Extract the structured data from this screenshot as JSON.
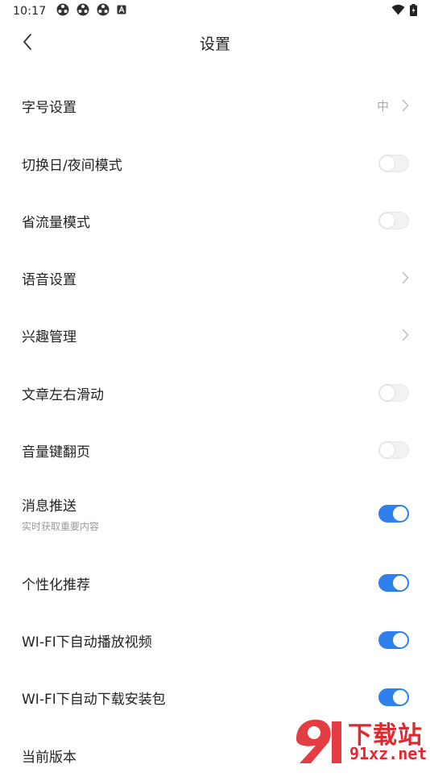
{
  "status_bar": {
    "time": "10:17",
    "notification_icons": [
      "app-icon",
      "app-icon",
      "app-icon",
      "a-icon"
    ],
    "right_icons": [
      "wifi-icon",
      "battery-charging-icon"
    ]
  },
  "nav": {
    "title": "设置"
  },
  "settings": [
    {
      "label": "字号设置",
      "type": "chevron",
      "value": "中"
    },
    {
      "label": "切换日/夜间模式",
      "type": "toggle",
      "on": false
    },
    {
      "label": "省流量模式",
      "type": "toggle",
      "on": false
    },
    {
      "label": "语音设置",
      "type": "chevron"
    },
    {
      "label": "兴趣管理",
      "type": "chevron"
    },
    {
      "label": "文章左右滑动",
      "type": "toggle",
      "on": false
    },
    {
      "label": "音量键翻页",
      "type": "toggle",
      "on": false
    },
    {
      "label": "消息推送",
      "sublabel": "实时获取重要内容",
      "type": "toggle",
      "on": true
    },
    {
      "label": "个性化推荐",
      "type": "toggle",
      "on": true
    },
    {
      "label": "WI-FI下自动播放视频",
      "type": "toggle",
      "on": true
    },
    {
      "label": "WI-FI下自动下载安装包",
      "type": "toggle",
      "on": true
    },
    {
      "label": "当前版本",
      "type": "none"
    }
  ],
  "watermark": {
    "title": "下载站",
    "url": "91xz.net"
  },
  "colors": {
    "accent": "#2f80ed",
    "watermark": "#e0282f"
  }
}
